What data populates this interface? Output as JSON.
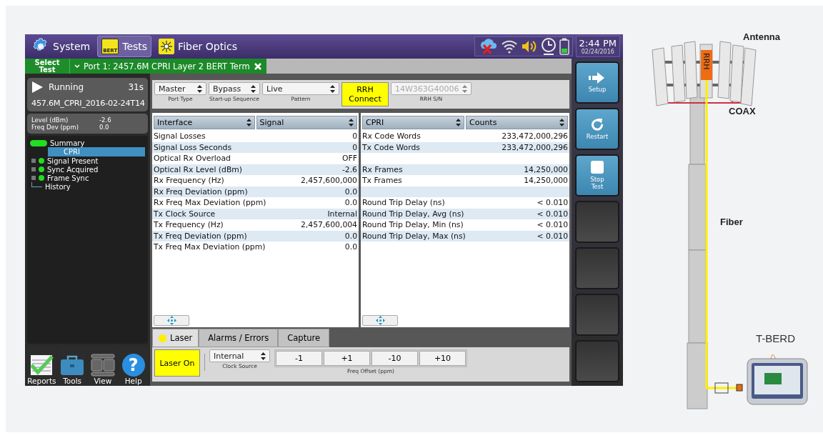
{
  "topbar": {
    "menus": [
      {
        "label": "System",
        "kind": "system",
        "selected": false
      },
      {
        "label": "Tests",
        "kind": "tests",
        "selected": true
      },
      {
        "label": "Fiber Optics",
        "kind": "fiber",
        "selected": false
      }
    ],
    "badge": "BERT",
    "time": "2:44 PM",
    "date": "02/24/2016"
  },
  "tabbar": {
    "select_test": "Select Test",
    "tab": "Port 1: 2457.6M CPRI Layer 2 BERT Term"
  },
  "status": {
    "state": "Running",
    "elapsed": "31s",
    "filename": "457.6M_CPRI_2016-02-24T14",
    "readings": [
      {
        "label": "Level (dBm)",
        "value": "-2.6"
      },
      {
        "label": "Freq Dev (ppm)",
        "value": "0.0"
      }
    ]
  },
  "tree": [
    {
      "kind": "summary",
      "label": "Summary"
    },
    {
      "kind": "page",
      "label": "CPRI",
      "selected": true
    },
    {
      "kind": "status",
      "label": "Signal Present"
    },
    {
      "kind": "status",
      "label": "Sync Acquired"
    },
    {
      "kind": "status",
      "label": "Frame Sync"
    },
    {
      "kind": "history",
      "label": "History"
    }
  ],
  "bottom_nav": [
    {
      "label": "Reports",
      "kind": "reports"
    },
    {
      "label": "Tools",
      "kind": "tools"
    },
    {
      "label": "View",
      "kind": "view"
    },
    {
      "label": "Help",
      "kind": "help",
      "glyph": "?"
    }
  ],
  "config": {
    "selects": [
      {
        "value": "Master",
        "caption": "Port Type"
      },
      {
        "value": "Bypass",
        "caption": "Start-up Sequence"
      },
      {
        "value": "Live",
        "caption": "Pattern"
      }
    ],
    "connect_button": "RRH Connect",
    "serial": {
      "value": "14W363G40006",
      "caption": "RRH S/N",
      "disabled": true
    }
  },
  "panels": [
    {
      "selectors": [
        "Interface",
        "Signal"
      ],
      "rows": [
        {
          "kind": "data",
          "label": "Signal Losses",
          "value": "0"
        },
        {
          "kind": "data",
          "label": "Signal Loss Seconds",
          "value": "0"
        },
        {
          "kind": "data",
          "label": "Optical Rx Overload",
          "value": "OFF"
        },
        {
          "kind": "data",
          "label": "Optical Rx Level (dBm)",
          "value": "-2.6"
        },
        {
          "kind": "data",
          "label": "Rx Frequency (Hz)",
          "value": "2,457,600,000"
        },
        {
          "kind": "data",
          "label": "Rx Freq Deviation (ppm)",
          "value": "0.0"
        },
        {
          "kind": "data",
          "label": "Rx Freq Max Deviation (ppm)",
          "value": "0.0"
        },
        {
          "kind": "data",
          "label": "Tx Clock Source",
          "value": "Internal"
        },
        {
          "kind": "data",
          "label": "Tx Frequency (Hz)",
          "value": "2,457,600,004"
        },
        {
          "kind": "data",
          "label": "Tx Freq Deviation (ppm)",
          "value": "0.0"
        },
        {
          "kind": "data",
          "label": "Tx Freq Max Deviation (ppm)",
          "value": "0.0"
        }
      ]
    },
    {
      "selectors": [
        "CPRI",
        "Counts"
      ],
      "rows": [
        {
          "kind": "data",
          "label": "Rx Code Words",
          "value": "233,472,000,296"
        },
        {
          "kind": "data",
          "label": "Tx Code Words",
          "value": "233,472,000,296"
        },
        {
          "kind": "blank"
        },
        {
          "kind": "data",
          "label": "Rx Frames",
          "value": "14,250,000"
        },
        {
          "kind": "data",
          "label": "Tx Frames",
          "value": "14,250,000"
        },
        {
          "kind": "blank"
        },
        {
          "kind": "data",
          "label": "Round Trip Delay (ns)",
          "value": "< 0.010"
        },
        {
          "kind": "data",
          "label": "Round Trip Delay, Avg (ns)",
          "value": "< 0.010"
        },
        {
          "kind": "data",
          "label": "Round Trip Delay, Min (ns)",
          "value": "< 0.010"
        },
        {
          "kind": "data",
          "label": "Round Trip Delay, Max (ns)",
          "value": "< 0.010"
        }
      ]
    }
  ],
  "bottom_tabs": [
    {
      "label": "Laser",
      "selected": true,
      "led": true
    },
    {
      "label": "Alarms / Errors",
      "selected": false,
      "led": false
    },
    {
      "label": "Capture",
      "selected": false,
      "led": false
    }
  ],
  "laser": {
    "button": "Laser On",
    "on": true,
    "clock": {
      "value": "Internal",
      "caption": "Clock Source"
    },
    "offsets": [
      "-1",
      "+1",
      "-10",
      "+10"
    ],
    "offset_caption": "Freq Offset (ppm)"
  },
  "actions": [
    {
      "kind": "setup",
      "label": "Setup"
    },
    {
      "kind": "restart",
      "label": "Restart"
    },
    {
      "kind": "stop",
      "label": "Stop Test"
    },
    {
      "kind": "empty"
    },
    {
      "kind": "empty"
    },
    {
      "kind": "empty"
    },
    {
      "kind": "empty"
    }
  ],
  "diagram": {
    "antenna": "Antenna",
    "coax": "COAX",
    "fiber": "Fiber",
    "device": "T-BERD",
    "rrh": "RRH"
  }
}
